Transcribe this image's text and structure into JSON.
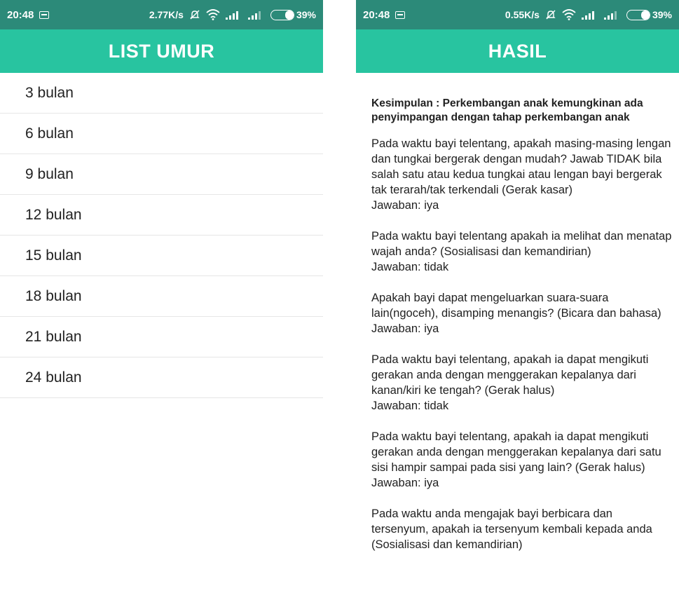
{
  "left_screen": {
    "status_bar": {
      "time": "20:48",
      "net_speed": "2.77K/s",
      "battery": "39%",
      "battery_level": 0.39
    },
    "title": "LIST UMUR",
    "items": [
      {
        "label": "3 bulan"
      },
      {
        "label": "6 bulan"
      },
      {
        "label": "9 bulan"
      },
      {
        "label": "12 bulan"
      },
      {
        "label": "15 bulan"
      },
      {
        "label": "18 bulan"
      },
      {
        "label": "21 bulan"
      },
      {
        "label": "24 bulan"
      }
    ]
  },
  "right_screen": {
    "status_bar": {
      "time": "20:48",
      "net_speed": "0.55K/s",
      "battery": "39%",
      "battery_level": 0.39
    },
    "title": "HASIL",
    "conclusion": "Kesimpulan : Perkembangan anak kemungkinan ada penyimpangan dengan tahap perkembangan anak",
    "questions": [
      {
        "question": "Pada waktu bayi telentang, apakah masing-masing lengan dan tungkai bergerak dengan mudah? Jawab TIDAK bila salah satu atau kedua tungkai atau lengan bayi bergerak tak terarah/tak terkendali (Gerak kasar)",
        "answer": "Jawaban: iya"
      },
      {
        "question": "Pada waktu bayi telentang apakah ia melihat dan menatap wajah anda? (Sosialisasi dan kemandirian)",
        "answer": "Jawaban: tidak"
      },
      {
        "question": "Apakah bayi dapat mengeluarkan suara-suara lain(ngoceh), disamping menangis? (Bicara dan bahasa)",
        "answer": "Jawaban: iya"
      },
      {
        "question": "Pada waktu bayi telentang, apakah ia dapat mengikuti gerakan anda dengan menggerakan kepalanya dari kanan/kiri ke tengah? (Gerak halus)",
        "answer": "Jawaban: tidak"
      },
      {
        "question": "Pada waktu bayi telentang, apakah ia dapat mengikuti gerakan anda dengan menggerakan kepalanya dari satu sisi hampir sampai pada sisi yang lain? (Gerak halus)",
        "answer": "Jawaban: iya"
      },
      {
        "question": "Pada waktu anda mengajak bayi berbicara dan tersenyum, apakah ia tersenyum kembali kepada anda (Sosialisasi dan kemandirian)",
        "answer": ""
      }
    ]
  },
  "colors": {
    "status_bar": "#2c8a79",
    "app_bar": "#28c4a0",
    "divider": "#e6e6e6",
    "text": "#222222"
  },
  "icons": {
    "notification": "notification-icon",
    "mute": "bell-off-icon",
    "wifi": "wifi-icon",
    "signal": "signal-icon",
    "battery": "battery-icon"
  }
}
